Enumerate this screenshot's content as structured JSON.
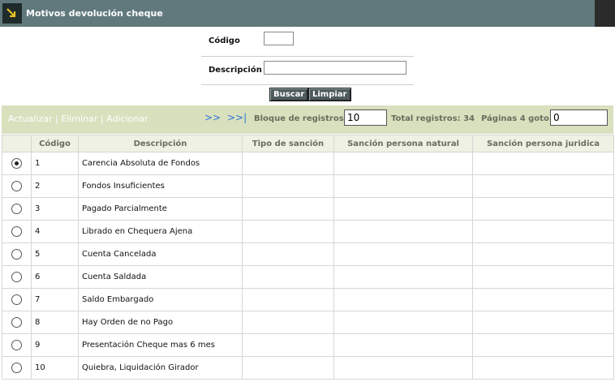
{
  "window": {
    "title": "Motivos devolución cheque",
    "icon": "arrow-down-right-icon"
  },
  "filters": {
    "codigo_label": "Código",
    "codigo_value": "",
    "descripcion_label": "Descripción",
    "descripcion_value": "",
    "buscar_label": "Buscar",
    "limpiar_label": "Limpiar"
  },
  "toolbar": {
    "actualizar": "Actualizar",
    "eliminar": "Eliminar",
    "adicionar": "Adicionar",
    "separator": "|",
    "next": ">>",
    "last": ">>|",
    "bloque_label": "Bloque de registros:",
    "bloque_value": "10",
    "total_label": "Total registros: 34",
    "paginas_label": "Páginas 4 goto:",
    "goto_value": "0"
  },
  "table": {
    "columns": [
      "",
      "Código",
      "Descripción",
      "Tipo de sanción",
      "Sanción persona natural",
      "Sanción persona juridica"
    ],
    "selected_index": 0,
    "rows": [
      {
        "codigo": "1",
        "descripcion": "Carencia Absoluta de Fondos",
        "tipo": "",
        "natural": "",
        "juridica": ""
      },
      {
        "codigo": "2",
        "descripcion": "Fondos Insuficientes",
        "tipo": "",
        "natural": "",
        "juridica": ""
      },
      {
        "codigo": "3",
        "descripcion": "Pagado Parcialmente",
        "tipo": "",
        "natural": "",
        "juridica": ""
      },
      {
        "codigo": "4",
        "descripcion": "Librado en Chequera Ajena",
        "tipo": "",
        "natural": "",
        "juridica": ""
      },
      {
        "codigo": "5",
        "descripcion": "Cuenta Cancelada",
        "tipo": "",
        "natural": "",
        "juridica": ""
      },
      {
        "codigo": "6",
        "descripcion": "Cuenta Saldada",
        "tipo": "",
        "natural": "",
        "juridica": ""
      },
      {
        "codigo": "7",
        "descripcion": "Saldo Embargado",
        "tipo": "",
        "natural": "",
        "juridica": ""
      },
      {
        "codigo": "8",
        "descripcion": "Hay Orden de no Pago",
        "tipo": "",
        "natural": "",
        "juridica": ""
      },
      {
        "codigo": "9",
        "descripcion": "Presentación Cheque mas 6 mes",
        "tipo": "",
        "natural": "",
        "juridica": ""
      },
      {
        "codigo": "10",
        "descripcion": "Quiebra, Liquidación Girador",
        "tipo": "",
        "natural": "",
        "juridica": ""
      }
    ]
  },
  "colors": {
    "header": "#61797d",
    "toolbar": "#d8e0be",
    "link": "#2e71d6",
    "label": "#676f5e"
  }
}
